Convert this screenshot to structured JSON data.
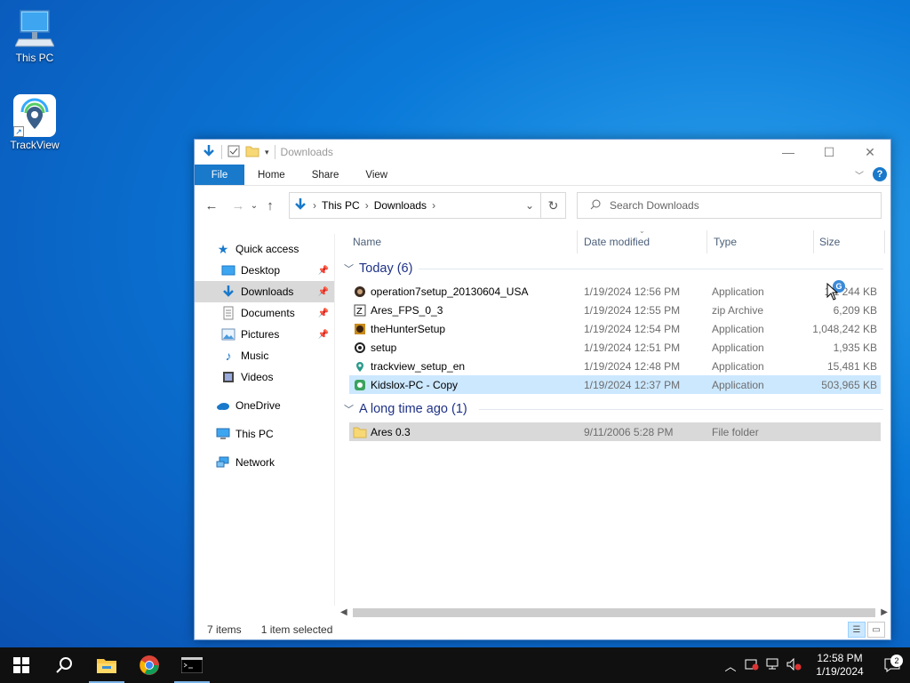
{
  "desktop": {
    "icons": [
      {
        "label": "This PC",
        "icon": "computer-icon"
      },
      {
        "label": "TrackView",
        "icon": "trackview-app-icon"
      }
    ]
  },
  "window": {
    "title": "Downloads",
    "ribbon_tabs": [
      "File",
      "Home",
      "Share",
      "View"
    ],
    "breadcrumb": [
      "This PC",
      "Downloads"
    ],
    "search_placeholder": "Search Downloads",
    "nav": {
      "quick_access": "Quick access",
      "items": [
        {
          "label": "Desktop",
          "pinned": true,
          "icon": "desktop-folder-icon"
        },
        {
          "label": "Downloads",
          "pinned": true,
          "selected": true,
          "icon": "downloads-folder-icon"
        },
        {
          "label": "Documents",
          "pinned": true,
          "icon": "documents-folder-icon"
        },
        {
          "label": "Pictures",
          "pinned": true,
          "icon": "pictures-folder-icon"
        },
        {
          "label": "Music",
          "pinned": false,
          "icon": "music-folder-icon"
        },
        {
          "label": "Videos",
          "pinned": false,
          "icon": "videos-folder-icon"
        }
      ],
      "onedrive": "OneDrive",
      "this_pc": "This PC",
      "network": "Network"
    },
    "columns": {
      "name": "Name",
      "date": "Date modified",
      "type": "Type",
      "size": "Size"
    },
    "groups": [
      {
        "label": "Today (6)",
        "files": [
          {
            "name": "operation7setup_20130604_USA",
            "date": "1/19/2024 12:56 PM",
            "type": "Application",
            "size": "1,1 244 KB",
            "icon": "operation7-app-icon"
          },
          {
            "name": "Ares_FPS_0_3",
            "date": "1/19/2024 12:55 PM",
            "type": "zip Archive",
            "size": "6,209 KB",
            "icon": "zip-archive-icon"
          },
          {
            "name": "theHunterSetup",
            "date": "1/19/2024 12:54 PM",
            "type": "Application",
            "size": "1,048,242 KB",
            "icon": "thehunter-app-icon"
          },
          {
            "name": "setup",
            "date": "1/19/2024 12:51 PM",
            "type": "Application",
            "size": "1,935 KB",
            "icon": "setup-app-icon"
          },
          {
            "name": "trackview_setup_en",
            "date": "1/19/2024 12:48 PM",
            "type": "Application",
            "size": "15,481 KB",
            "icon": "trackview-app-icon"
          },
          {
            "name": "Kidslox-PC - Copy",
            "date": "1/19/2024 12:37 PM",
            "type": "Application",
            "size": "503,965 KB",
            "icon": "kidslox-app-icon",
            "selected": true
          }
        ]
      },
      {
        "label": "A long time ago (1)",
        "files": [
          {
            "name": "Ares 0.3",
            "date": "9/11/2006 5:28 PM",
            "type": "File folder",
            "size": "",
            "icon": "folder-icon",
            "hovered": true
          }
        ]
      }
    ],
    "status": {
      "items": "7 items",
      "selected": "1 item selected"
    }
  },
  "taskbar": {
    "time": "12:58 PM",
    "date": "1/19/2024",
    "notifications": "2"
  },
  "colors": {
    "accent": "#1979ca",
    "selection": "#cce8ff",
    "group_text": "#1e3287",
    "taskbar": "#101010"
  }
}
